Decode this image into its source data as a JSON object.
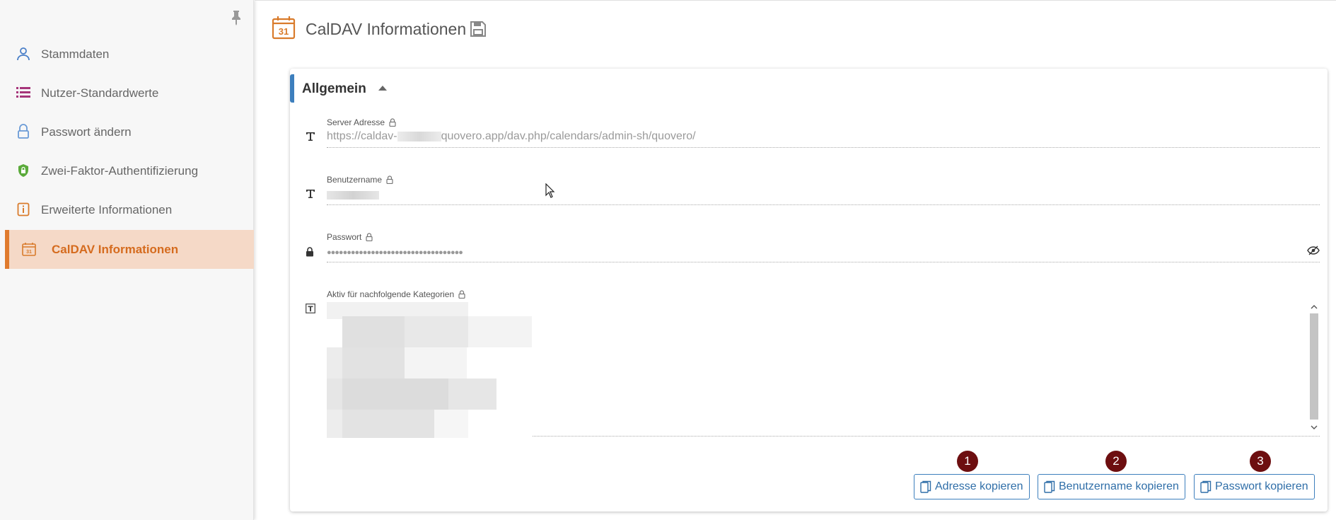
{
  "sidebar": {
    "items": [
      {
        "label": "Stammdaten",
        "icon": "user-icon",
        "color": "#4a7fc8"
      },
      {
        "label": "Nutzer-Standardwerte",
        "icon": "list-icon",
        "color": "#a6357a"
      },
      {
        "label": "Passwort ändern",
        "icon": "lock-icon",
        "color": "#6b9bd6"
      },
      {
        "label": "Zwei-Faktor-Authentifizierung",
        "icon": "shield-lock-icon",
        "color": "#5aaa3a"
      },
      {
        "label": "Erweiterte Informationen",
        "icon": "info-icon",
        "color": "#d97b2b"
      },
      {
        "label": "CalDAV Informationen",
        "icon": "calendar-icon",
        "color": "#d97b2b",
        "active": true
      }
    ]
  },
  "header": {
    "calendar_day": "31",
    "title": "CalDAV Informationen"
  },
  "section": {
    "title": "Allgemein"
  },
  "fields": {
    "server": {
      "label": "Server Adresse",
      "value_prefix": "https://caldav-",
      "value_suffix": "quovero.app/dav.php/calendars/admin-sh/quovero/"
    },
    "username": {
      "label": "Benutzername"
    },
    "password": {
      "label": "Passwort",
      "value": "●●●●●●●●●●●●●●●●●●●●●●●●●●●●●●●●●●"
    },
    "categories": {
      "label": "Aktiv für nachfolgende Kategorien"
    }
  },
  "buttons": [
    {
      "badge": "1",
      "label": "Adresse kopieren"
    },
    {
      "badge": "2",
      "label": "Benutzername kopieren"
    },
    {
      "badge": "3",
      "label": "Passwort kopieren"
    }
  ],
  "colors": {
    "accent": "#e07b2e",
    "primary": "#3d7fbd",
    "badge": "#6d0e10"
  }
}
